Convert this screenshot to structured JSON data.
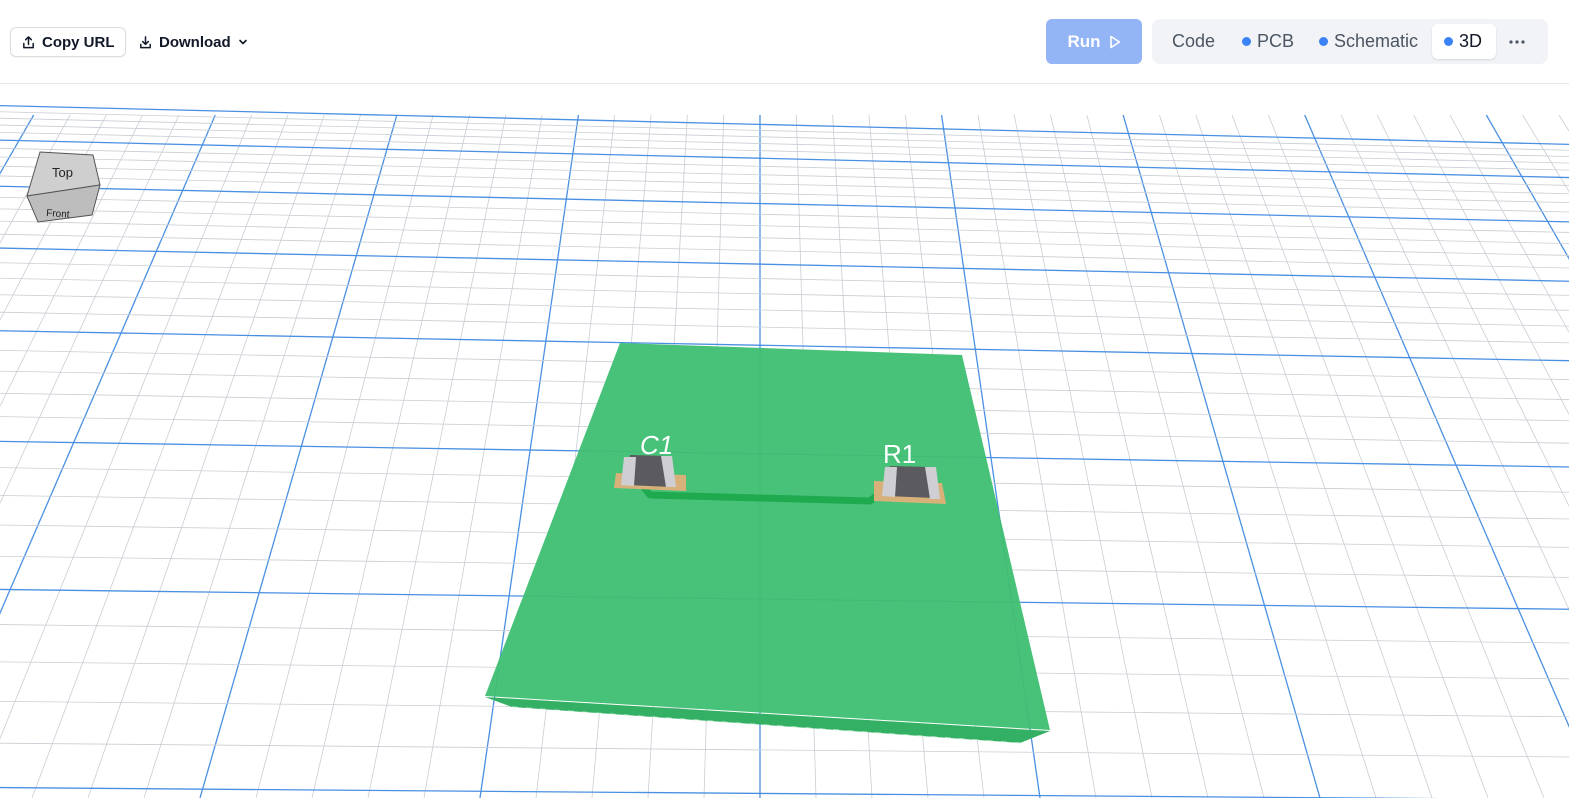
{
  "toolbar": {
    "copy_url_label": "Copy URL",
    "download_label": "Download",
    "run_label": "Run"
  },
  "tabs": [
    {
      "label": "Code",
      "dot": false,
      "active": false
    },
    {
      "label": "PCB",
      "dot": true,
      "active": false
    },
    {
      "label": "Schematic",
      "dot": true,
      "active": false
    },
    {
      "label": "3D",
      "dot": true,
      "active": true
    }
  ],
  "icons": {
    "copy_url": "share-upload-icon",
    "download": "download-icon",
    "download_caret": "chevron-down-icon",
    "run": "play-icon",
    "more": "more-horizontal-icon"
  },
  "view_cube": {
    "top_label": "Top",
    "front_label": "Front"
  },
  "components": [
    {
      "designator": "C1"
    },
    {
      "designator": "R1"
    }
  ],
  "colors": {
    "accent": "#3b82f6",
    "run_button": "#93b4f5",
    "board": "#3fbf72",
    "trace": "#1faa4f",
    "pad": "#d8b07a",
    "grid_minor": "#c9cdd3",
    "grid_major": "#4a90e2"
  }
}
